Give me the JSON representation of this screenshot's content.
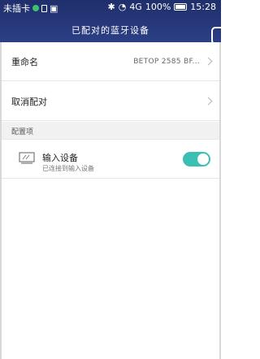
{
  "status_bar": {
    "carrier": "未插卡",
    "network": "4G",
    "battery": "100%",
    "time": "15:28"
  },
  "header": {
    "title": "已配对的蓝牙设备"
  },
  "rows": [
    {
      "label": "重命名",
      "value": "BETOP 2585 BF..."
    },
    {
      "label": "取消配对",
      "value": ""
    }
  ],
  "section": {
    "label": "配置项"
  },
  "device": {
    "title": "输入设备",
    "subtitle": "已连接到输入设备",
    "toggle_on": true
  },
  "colors": {
    "header_start": "#1f2f6b",
    "header_end": "#2c3f86",
    "toggle": "#3bbfb2"
  }
}
